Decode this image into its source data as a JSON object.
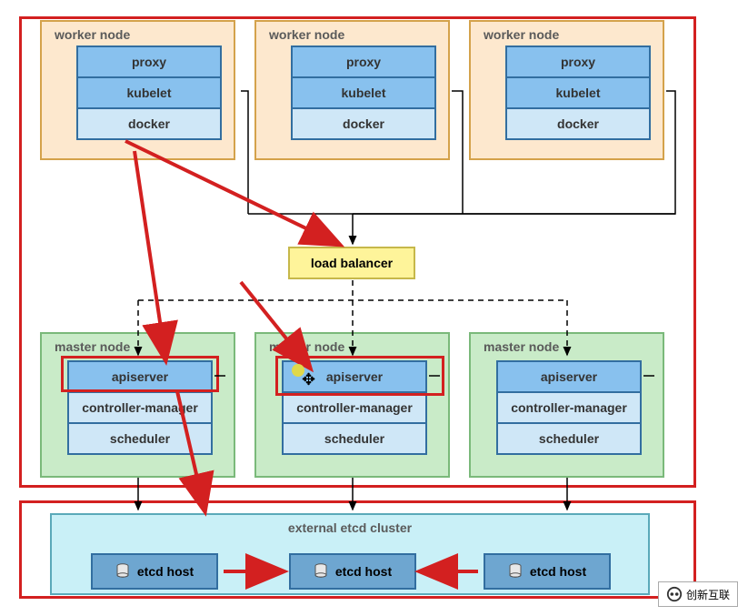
{
  "diagram": {
    "worker_label": "worker node",
    "worker_components": {
      "proxy": "proxy",
      "kubelet": "kubelet",
      "docker": "docker"
    },
    "load_balancer": "load balancer",
    "master_label": "master node",
    "master_components": {
      "apiserver": "apiserver",
      "cm": "controller-manager",
      "scheduler": "scheduler"
    },
    "etcd_cluster_label": "external etcd cluster",
    "etcd_host_label": "etcd host"
  },
  "watermark": "创新互联"
}
